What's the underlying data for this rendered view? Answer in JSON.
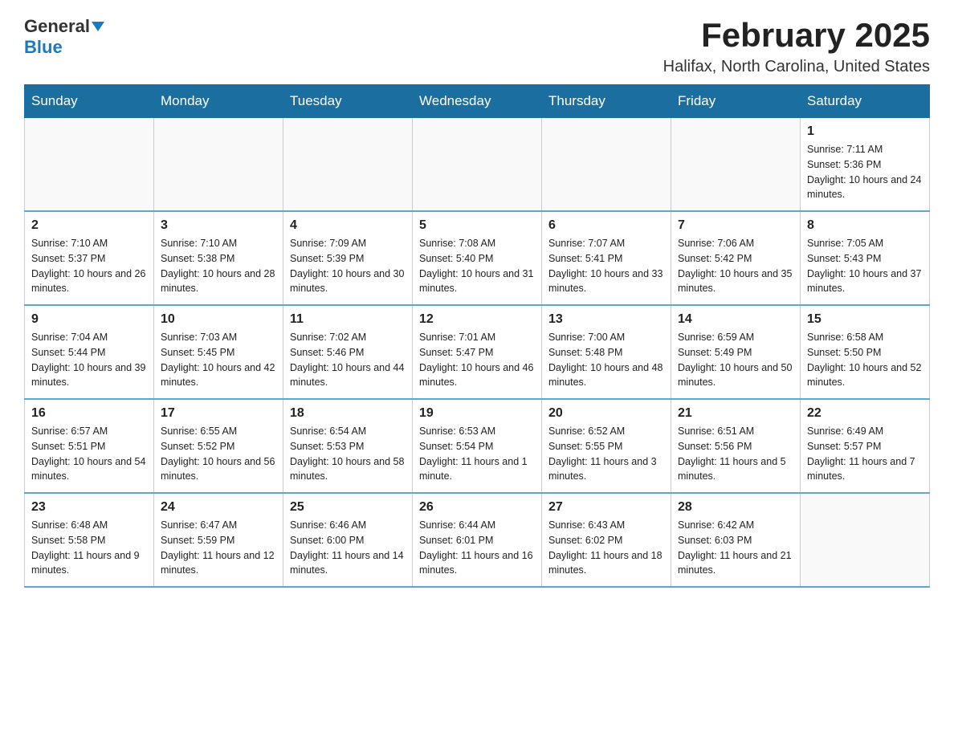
{
  "logo": {
    "general": "General",
    "blue": "Blue"
  },
  "title": "February 2025",
  "location": "Halifax, North Carolina, United States",
  "days_of_week": [
    "Sunday",
    "Monday",
    "Tuesday",
    "Wednesday",
    "Thursday",
    "Friday",
    "Saturday"
  ],
  "weeks": [
    [
      {
        "day": "",
        "info": ""
      },
      {
        "day": "",
        "info": ""
      },
      {
        "day": "",
        "info": ""
      },
      {
        "day": "",
        "info": ""
      },
      {
        "day": "",
        "info": ""
      },
      {
        "day": "",
        "info": ""
      },
      {
        "day": "1",
        "info": "Sunrise: 7:11 AM\nSunset: 5:36 PM\nDaylight: 10 hours and 24 minutes."
      }
    ],
    [
      {
        "day": "2",
        "info": "Sunrise: 7:10 AM\nSunset: 5:37 PM\nDaylight: 10 hours and 26 minutes."
      },
      {
        "day": "3",
        "info": "Sunrise: 7:10 AM\nSunset: 5:38 PM\nDaylight: 10 hours and 28 minutes."
      },
      {
        "day": "4",
        "info": "Sunrise: 7:09 AM\nSunset: 5:39 PM\nDaylight: 10 hours and 30 minutes."
      },
      {
        "day": "5",
        "info": "Sunrise: 7:08 AM\nSunset: 5:40 PM\nDaylight: 10 hours and 31 minutes."
      },
      {
        "day": "6",
        "info": "Sunrise: 7:07 AM\nSunset: 5:41 PM\nDaylight: 10 hours and 33 minutes."
      },
      {
        "day": "7",
        "info": "Sunrise: 7:06 AM\nSunset: 5:42 PM\nDaylight: 10 hours and 35 minutes."
      },
      {
        "day": "8",
        "info": "Sunrise: 7:05 AM\nSunset: 5:43 PM\nDaylight: 10 hours and 37 minutes."
      }
    ],
    [
      {
        "day": "9",
        "info": "Sunrise: 7:04 AM\nSunset: 5:44 PM\nDaylight: 10 hours and 39 minutes."
      },
      {
        "day": "10",
        "info": "Sunrise: 7:03 AM\nSunset: 5:45 PM\nDaylight: 10 hours and 42 minutes."
      },
      {
        "day": "11",
        "info": "Sunrise: 7:02 AM\nSunset: 5:46 PM\nDaylight: 10 hours and 44 minutes."
      },
      {
        "day": "12",
        "info": "Sunrise: 7:01 AM\nSunset: 5:47 PM\nDaylight: 10 hours and 46 minutes."
      },
      {
        "day": "13",
        "info": "Sunrise: 7:00 AM\nSunset: 5:48 PM\nDaylight: 10 hours and 48 minutes."
      },
      {
        "day": "14",
        "info": "Sunrise: 6:59 AM\nSunset: 5:49 PM\nDaylight: 10 hours and 50 minutes."
      },
      {
        "day": "15",
        "info": "Sunrise: 6:58 AM\nSunset: 5:50 PM\nDaylight: 10 hours and 52 minutes."
      }
    ],
    [
      {
        "day": "16",
        "info": "Sunrise: 6:57 AM\nSunset: 5:51 PM\nDaylight: 10 hours and 54 minutes."
      },
      {
        "day": "17",
        "info": "Sunrise: 6:55 AM\nSunset: 5:52 PM\nDaylight: 10 hours and 56 minutes."
      },
      {
        "day": "18",
        "info": "Sunrise: 6:54 AM\nSunset: 5:53 PM\nDaylight: 10 hours and 58 minutes."
      },
      {
        "day": "19",
        "info": "Sunrise: 6:53 AM\nSunset: 5:54 PM\nDaylight: 11 hours and 1 minute."
      },
      {
        "day": "20",
        "info": "Sunrise: 6:52 AM\nSunset: 5:55 PM\nDaylight: 11 hours and 3 minutes."
      },
      {
        "day": "21",
        "info": "Sunrise: 6:51 AM\nSunset: 5:56 PM\nDaylight: 11 hours and 5 minutes."
      },
      {
        "day": "22",
        "info": "Sunrise: 6:49 AM\nSunset: 5:57 PM\nDaylight: 11 hours and 7 minutes."
      }
    ],
    [
      {
        "day": "23",
        "info": "Sunrise: 6:48 AM\nSunset: 5:58 PM\nDaylight: 11 hours and 9 minutes."
      },
      {
        "day": "24",
        "info": "Sunrise: 6:47 AM\nSunset: 5:59 PM\nDaylight: 11 hours and 12 minutes."
      },
      {
        "day": "25",
        "info": "Sunrise: 6:46 AM\nSunset: 6:00 PM\nDaylight: 11 hours and 14 minutes."
      },
      {
        "day": "26",
        "info": "Sunrise: 6:44 AM\nSunset: 6:01 PM\nDaylight: 11 hours and 16 minutes."
      },
      {
        "day": "27",
        "info": "Sunrise: 6:43 AM\nSunset: 6:02 PM\nDaylight: 11 hours and 18 minutes."
      },
      {
        "day": "28",
        "info": "Sunrise: 6:42 AM\nSunset: 6:03 PM\nDaylight: 11 hours and 21 minutes."
      },
      {
        "day": "",
        "info": ""
      }
    ]
  ]
}
